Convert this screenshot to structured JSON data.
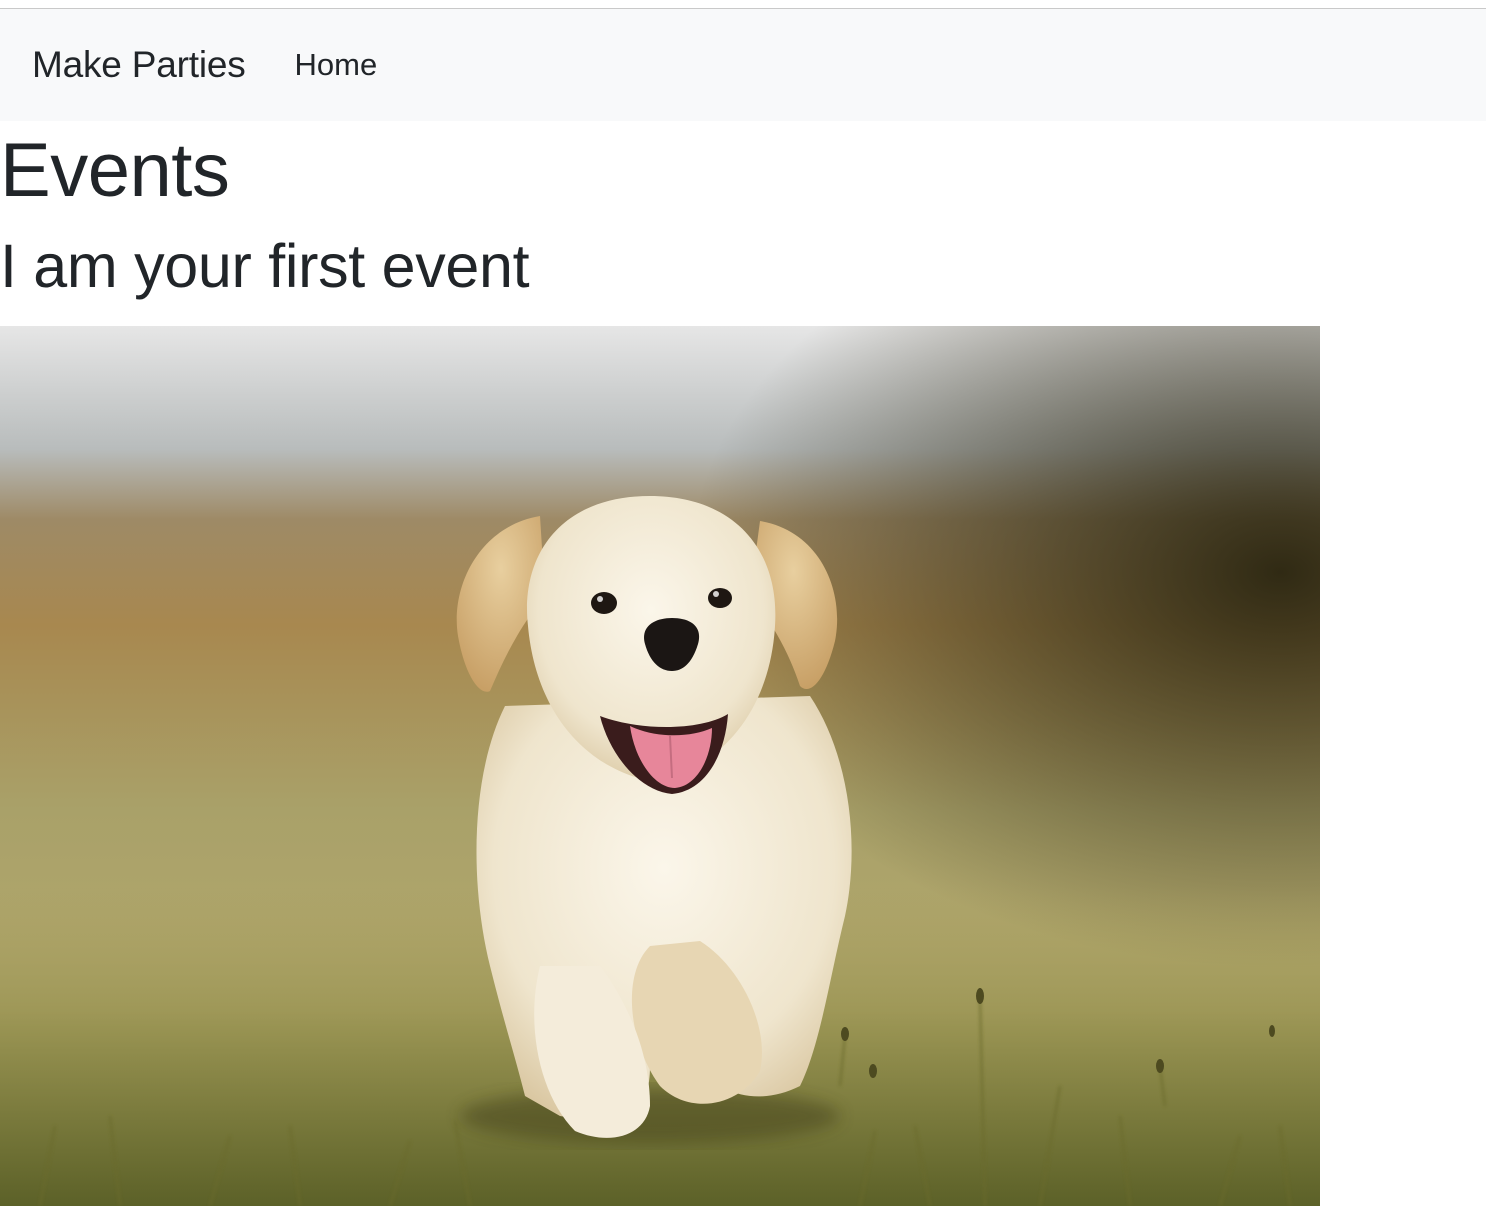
{
  "navbar": {
    "brand": "Make Parties",
    "links": [
      {
        "label": "Home"
      }
    ]
  },
  "main": {
    "title": "Events",
    "events": [
      {
        "title": "I am your first event",
        "image_subject": "golden-retriever-puppy-on-grass"
      }
    ]
  },
  "colors": {
    "navbar_bg": "#f8f9fa",
    "text": "#212529"
  }
}
